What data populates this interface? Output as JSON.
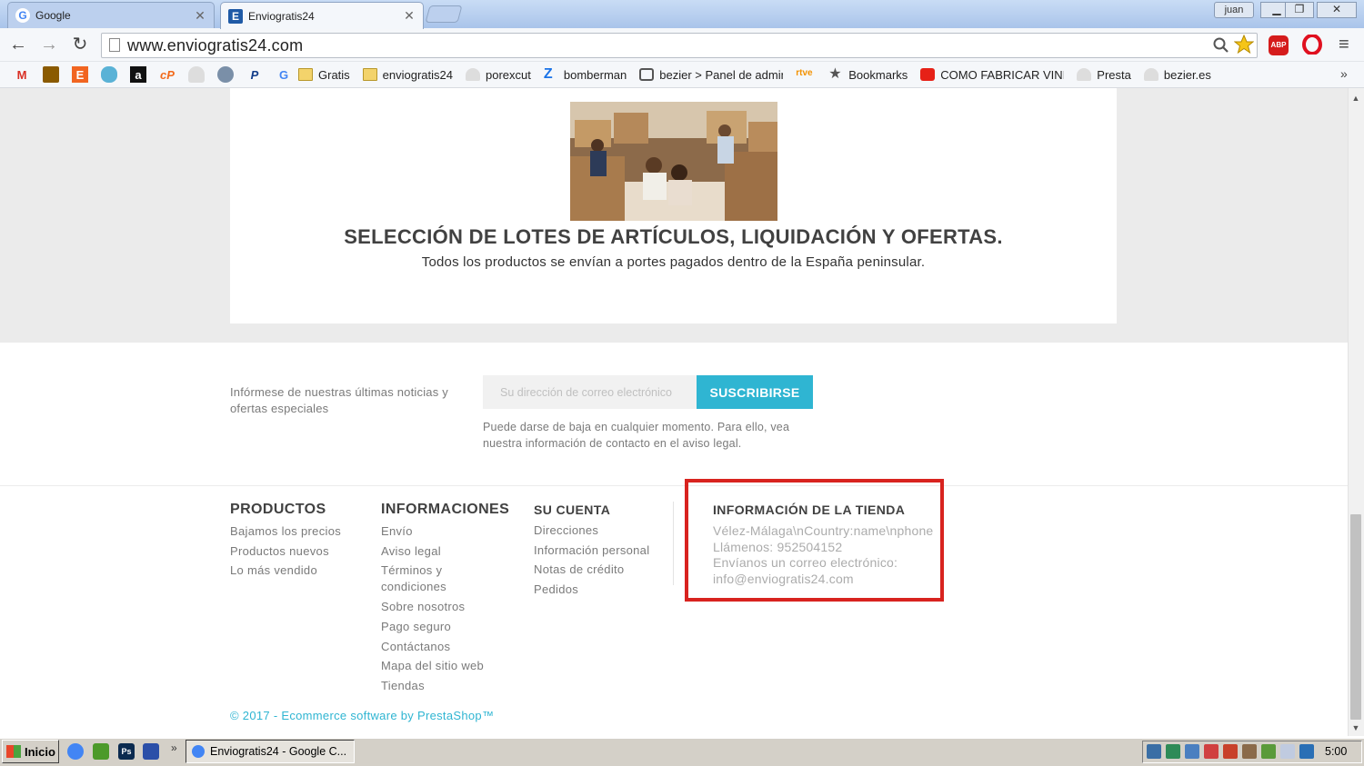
{
  "browser": {
    "tabs": [
      {
        "title": "Google",
        "icon": "google-g-icon",
        "active": false
      },
      {
        "title": "Enviogratis24",
        "icon": "enviogratis-e-icon",
        "active": true
      }
    ],
    "profile_label": "juan",
    "address": "www.enviogratis24.com",
    "bookmarks": [
      {
        "label": "",
        "icon": "gmail-icon"
      },
      {
        "label": "",
        "icon": "shopping-bag-icon"
      },
      {
        "label": "",
        "icon": "etsy-icon"
      },
      {
        "label": "",
        "icon": "character-icon"
      },
      {
        "label": "",
        "icon": "amazon-icon"
      },
      {
        "label": "",
        "icon": "cp-icon"
      },
      {
        "label": "",
        "icon": "cloud-icon"
      },
      {
        "label": "",
        "icon": "globe-icon"
      },
      {
        "label": "",
        "icon": "paypal-icon"
      },
      {
        "label": "",
        "icon": "google-icon"
      },
      {
        "label": "Gratis",
        "icon": "folder-icon"
      },
      {
        "label": "enviogratis24",
        "icon": "folder-icon"
      },
      {
        "label": "porexcut",
        "icon": "cloud-icon"
      },
      {
        "label": "bomberman",
        "icon": "z-icon"
      },
      {
        "label": "bezier > Panel de admin",
        "icon": "lock-icon"
      },
      {
        "label": "",
        "icon": "rtve-icon"
      },
      {
        "label": "Bookmarks",
        "icon": "star-icon"
      },
      {
        "label": "COMO FABRICAR VINIL",
        "icon": "youtube-icon"
      },
      {
        "label": "Presta",
        "icon": "cloud-icon"
      },
      {
        "label": "bezier.es",
        "icon": "cloud-icon"
      }
    ]
  },
  "page": {
    "headline": "SELECCIÓN DE LOTES DE ARTÍCULOS, LIQUIDACIÓN Y OFERTAS.",
    "subline": "Todos los productos se envían a portes pagados dentro de la España peninsular.",
    "newsletter": {
      "text": "Infórmese de nuestras últimas noticias y ofertas especiales",
      "placeholder": "Su dirección de correo electrónico",
      "button": "SUSCRIBIRSE",
      "note": "Puede darse de baja en cualquier momento. Para ello, vea nuestra información de contacto en el aviso legal."
    },
    "footer": {
      "products": {
        "title": "PRODUCTOS",
        "links": [
          "Bajamos los precios",
          "Productos nuevos",
          "Lo más vendido"
        ]
      },
      "info": {
        "title": "INFORMACIONES",
        "links": [
          "Envío",
          "Aviso legal",
          "Términos y condiciones",
          "Sobre nosotros",
          "Pago seguro",
          "Contáctanos",
          "Mapa del sitio web",
          "Tiendas"
        ]
      },
      "account": {
        "title": "SU CUENTA",
        "links": [
          "Direcciones",
          "Información personal",
          "Notas de crédito",
          "Pedidos"
        ]
      },
      "store": {
        "title": "INFORMACIÓN DE LA TIENDA",
        "lines": [
          "Vélez-Málaga\\nCountry:name\\nphone",
          "Llámenos: 952504152",
          "Envíanos un correo electrónico:",
          "info@enviogratis24.com"
        ]
      },
      "copyright": "© 2017 - Ecommerce software by PrestaShop™"
    },
    "highlight_color": "#d8231f",
    "accent_color": "#2fb5d2"
  },
  "taskbar": {
    "start_label": "Inicio",
    "task_label": "Enviogratis24 - Google C...",
    "clock": "5:00"
  }
}
